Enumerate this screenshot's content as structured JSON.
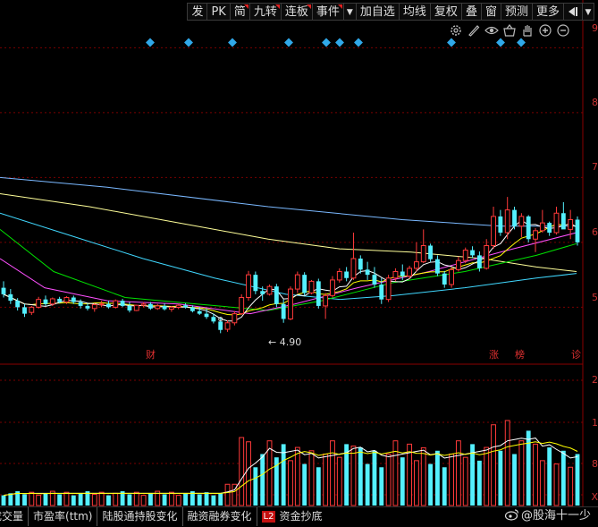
{
  "toolbar": {
    "buttons": [
      {
        "label": "发",
        "marked": false
      },
      {
        "label": "PK",
        "marked": false
      },
      {
        "label": "简",
        "marked": true
      },
      {
        "label": "九转",
        "marked": true
      },
      {
        "label": "连板",
        "marked": true
      },
      {
        "label": "事件",
        "marked": true
      }
    ],
    "buttons2": [
      {
        "label": "加自选"
      },
      {
        "label": "均线"
      },
      {
        "label": "复权"
      },
      {
        "label": "叠"
      },
      {
        "label": "窗"
      },
      {
        "label": "预测"
      },
      {
        "label": "更多"
      }
    ],
    "dropdown_glyph": "▼",
    "arrow_glyph": "◀"
  },
  "icons": [
    "settings-icon",
    "draw-pen-icon",
    "eye-icon",
    "basket-icon",
    "hand-icon",
    "zoom-in-icon",
    "zoom-out-icon"
  ],
  "price_axis": {
    "labels": [
      "9",
      "8",
      "7",
      "6",
      "5"
    ]
  },
  "volume_axis": {
    "labels": [
      "2",
      "1",
      "8",
      "X"
    ]
  },
  "low_label": "4.90",
  "markers": {
    "cai": "财",
    "zhang": "涨",
    "bang": "榜",
    "zhen": "诊"
  },
  "colors": {
    "up": "#ff3a3a",
    "down": "#54f0ff",
    "ma5": "#ffffff",
    "ma10": "#ffff00",
    "ma20": "#ff50ff",
    "ma30": "#00e000",
    "ma60": "#40d8ff",
    "ma120": "#ffff99",
    "ma250": "#7ab8ff",
    "diamond": "#30a8e8",
    "grid": "#7a0000"
  },
  "tabs": [
    {
      "label": "成交量",
      "badge": ""
    },
    {
      "label": "市盈率(ttm)",
      "badge": ""
    },
    {
      "label": "陆股通持股变化",
      "badge": ""
    },
    {
      "label": "融资融券变化",
      "badge": ""
    },
    {
      "label": "资金抄底",
      "badge": "L2"
    }
  ],
  "watermark": "@股海十一少",
  "chart_data": {
    "type": "candlestick",
    "ylim": [
      4.5,
      9.0
    ],
    "low_price": 4.9,
    "candles": [
      {
        "o": 5.3,
        "h": 5.4,
        "l": 5.15,
        "c": 5.2
      },
      {
        "o": 5.2,
        "h": 5.28,
        "l": 5.05,
        "c": 5.1
      },
      {
        "o": 5.1,
        "h": 5.14,
        "l": 4.95,
        "c": 5.0
      },
      {
        "o": 5.0,
        "h": 5.05,
        "l": 4.85,
        "c": 4.9
      },
      {
        "o": 4.92,
        "h": 5.02,
        "l": 4.88,
        "c": 5.0
      },
      {
        "o": 5.0,
        "h": 5.16,
        "l": 4.98,
        "c": 5.12
      },
      {
        "o": 5.12,
        "h": 5.18,
        "l": 5.02,
        "c": 5.05
      },
      {
        "o": 5.05,
        "h": 5.15,
        "l": 5.02,
        "c": 5.13
      },
      {
        "o": 5.13,
        "h": 5.16,
        "l": 5.06,
        "c": 5.08
      },
      {
        "o": 5.08,
        "h": 5.17,
        "l": 5.05,
        "c": 5.15
      },
      {
        "o": 5.15,
        "h": 5.18,
        "l": 5.05,
        "c": 5.08
      },
      {
        "o": 5.08,
        "h": 5.12,
        "l": 4.98,
        "c": 5.02
      },
      {
        "o": 5.02,
        "h": 5.06,
        "l": 4.95,
        "c": 4.98
      },
      {
        "o": 4.98,
        "h": 5.06,
        "l": 4.93,
        "c": 5.04
      },
      {
        "o": 5.04,
        "h": 5.1,
        "l": 5.0,
        "c": 5.05
      },
      {
        "o": 5.05,
        "h": 5.1,
        "l": 4.98,
        "c": 5.0
      },
      {
        "o": 5.0,
        "h": 5.12,
        "l": 4.98,
        "c": 5.1
      },
      {
        "o": 5.1,
        "h": 5.13,
        "l": 5.0,
        "c": 5.02
      },
      {
        "o": 5.02,
        "h": 5.08,
        "l": 4.92,
        "c": 4.95
      },
      {
        "o": 4.95,
        "h": 5.04,
        "l": 4.94,
        "c": 5.03
      },
      {
        "o": 5.03,
        "h": 5.08,
        "l": 5.0,
        "c": 5.05
      },
      {
        "o": 5.05,
        "h": 5.08,
        "l": 4.96,
        "c": 4.98
      },
      {
        "o": 4.98,
        "h": 5.05,
        "l": 4.96,
        "c": 5.02
      },
      {
        "o": 5.02,
        "h": 5.06,
        "l": 4.95,
        "c": 4.97
      },
      {
        "o": 4.97,
        "h": 5.02,
        "l": 4.93,
        "c": 5.0
      },
      {
        "o": 5.0,
        "h": 5.05,
        "l": 4.97,
        "c": 5.03
      },
      {
        "o": 5.03,
        "h": 5.06,
        "l": 4.98,
        "c": 5.0
      },
      {
        "o": 5.0,
        "h": 5.03,
        "l": 4.92,
        "c": 4.94
      },
      {
        "o": 4.94,
        "h": 5.0,
        "l": 4.88,
        "c": 4.9
      },
      {
        "o": 4.9,
        "h": 4.98,
        "l": 4.82,
        "c": 4.85
      },
      {
        "o": 4.85,
        "h": 4.9,
        "l": 4.75,
        "c": 4.78
      },
      {
        "o": 4.78,
        "h": 4.84,
        "l": 4.6,
        "c": 4.65
      },
      {
        "o": 4.66,
        "h": 4.8,
        "l": 4.62,
        "c": 4.76
      },
      {
        "o": 4.76,
        "h": 4.94,
        "l": 4.72,
        "c": 4.9
      },
      {
        "o": 4.9,
        "h": 5.2,
        "l": 4.88,
        "c": 5.15
      },
      {
        "o": 5.15,
        "h": 5.56,
        "l": 5.1,
        "c": 5.5
      },
      {
        "o": 5.5,
        "h": 5.55,
        "l": 5.2,
        "c": 5.25
      },
      {
        "o": 5.25,
        "h": 5.32,
        "l": 5.1,
        "c": 5.2
      },
      {
        "o": 5.2,
        "h": 5.35,
        "l": 5.18,
        "c": 5.32
      },
      {
        "o": 5.32,
        "h": 5.36,
        "l": 5.0,
        "c": 5.05
      },
      {
        "o": 5.05,
        "h": 5.12,
        "l": 4.76,
        "c": 4.82
      },
      {
        "o": 4.82,
        "h": 5.32,
        "l": 4.8,
        "c": 5.28
      },
      {
        "o": 5.28,
        "h": 5.55,
        "l": 5.22,
        "c": 5.5
      },
      {
        "o": 5.5,
        "h": 5.54,
        "l": 5.18,
        "c": 5.22
      },
      {
        "o": 5.22,
        "h": 5.42,
        "l": 5.2,
        "c": 5.4
      },
      {
        "o": 5.4,
        "h": 5.44,
        "l": 4.98,
        "c": 5.02
      },
      {
        "o": 5.02,
        "h": 5.22,
        "l": 4.82,
        "c": 5.18
      },
      {
        "o": 5.18,
        "h": 5.48,
        "l": 5.15,
        "c": 5.42
      },
      {
        "o": 5.42,
        "h": 5.6,
        "l": 5.38,
        "c": 5.55
      },
      {
        "o": 5.55,
        "h": 5.62,
        "l": 5.4,
        "c": 5.45
      },
      {
        "o": 5.45,
        "h": 6.15,
        "l": 5.42,
        "c": 5.75
      },
      {
        "o": 5.75,
        "h": 5.8,
        "l": 5.52,
        "c": 5.58
      },
      {
        "o": 5.58,
        "h": 5.7,
        "l": 5.42,
        "c": 5.5
      },
      {
        "o": 5.5,
        "h": 5.62,
        "l": 5.3,
        "c": 5.35
      },
      {
        "o": 5.35,
        "h": 5.45,
        "l": 5.05,
        "c": 5.12
      },
      {
        "o": 5.12,
        "h": 5.5,
        "l": 5.08,
        "c": 5.45
      },
      {
        "o": 5.45,
        "h": 5.6,
        "l": 5.4,
        "c": 5.55
      },
      {
        "o": 5.55,
        "h": 5.66,
        "l": 5.42,
        "c": 5.48
      },
      {
        "o": 5.48,
        "h": 5.64,
        "l": 5.44,
        "c": 5.6
      },
      {
        "o": 5.6,
        "h": 6.0,
        "l": 5.55,
        "c": 5.7
      },
      {
        "o": 5.7,
        "h": 6.2,
        "l": 5.68,
        "c": 5.95
      },
      {
        "o": 5.95,
        "h": 5.98,
        "l": 5.7,
        "c": 5.74
      },
      {
        "o": 5.74,
        "h": 5.8,
        "l": 5.48,
        "c": 5.52
      },
      {
        "o": 5.52,
        "h": 5.56,
        "l": 5.3,
        "c": 5.35
      },
      {
        "o": 5.35,
        "h": 5.62,
        "l": 5.3,
        "c": 5.58
      },
      {
        "o": 5.58,
        "h": 5.78,
        "l": 5.55,
        "c": 5.72
      },
      {
        "o": 5.72,
        "h": 5.92,
        "l": 5.68,
        "c": 5.88
      },
      {
        "o": 5.88,
        "h": 5.94,
        "l": 5.76,
        "c": 5.8
      },
      {
        "o": 5.8,
        "h": 5.86,
        "l": 5.55,
        "c": 5.6
      },
      {
        "o": 5.6,
        "h": 6.05,
        "l": 5.58,
        "c": 5.95
      },
      {
        "o": 5.95,
        "h": 6.55,
        "l": 5.9,
        "c": 6.4
      },
      {
        "o": 6.4,
        "h": 6.5,
        "l": 6.1,
        "c": 6.15
      },
      {
        "o": 6.15,
        "h": 6.7,
        "l": 6.05,
        "c": 6.5
      },
      {
        "o": 6.5,
        "h": 6.55,
        "l": 6.2,
        "c": 6.25
      },
      {
        "o": 6.25,
        "h": 6.45,
        "l": 6.08,
        "c": 6.4
      },
      {
        "o": 6.4,
        "h": 6.42,
        "l": 6.0,
        "c": 6.05
      },
      {
        "o": 6.05,
        "h": 6.22,
        "l": 5.85,
        "c": 6.18
      },
      {
        "o": 6.18,
        "h": 6.5,
        "l": 6.15,
        "c": 6.3
      },
      {
        "o": 6.3,
        "h": 6.32,
        "l": 6.1,
        "c": 6.15
      },
      {
        "o": 6.15,
        "h": 6.55,
        "l": 6.12,
        "c": 6.45
      },
      {
        "o": 6.45,
        "h": 6.62,
        "l": 6.4,
        "c": 6.2
      },
      {
        "o": 6.2,
        "h": 6.5,
        "l": 6.05,
        "c": 6.35
      },
      {
        "o": 6.35,
        "h": 6.4,
        "l": 5.95,
        "c": 6.0
      }
    ]
  }
}
